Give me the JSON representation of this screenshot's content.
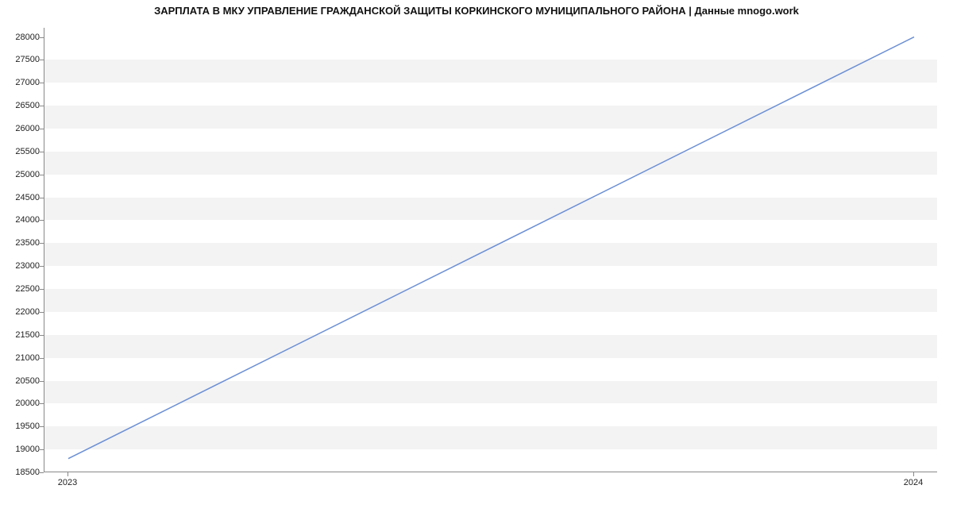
{
  "chart_data": {
    "type": "line",
    "title": "ЗАРПЛАТА В МКУ УПРАВЛЕНИЕ ГРАЖДАНСКОЙ ЗАЩИТЫ КОРКИНСКОГО МУНИЦИПАЛЬНОГО РАЙОНА | Данные mnogo.work",
    "xlabel": "",
    "ylabel": "",
    "x_categories": [
      "2023",
      "2024"
    ],
    "y_ticks": [
      18500,
      19000,
      19500,
      20000,
      20500,
      21000,
      21500,
      22000,
      22500,
      23000,
      23500,
      24000,
      24500,
      25000,
      25500,
      26000,
      26500,
      27000,
      27500,
      28000
    ],
    "ylim": [
      18500,
      28200
    ],
    "series": [
      {
        "name": "salary",
        "x": [
          "2023",
          "2024"
        ],
        "values": [
          18800,
          28000
        ]
      }
    ],
    "line_color": "#6b8fd4",
    "band_color": "#f3f3f4"
  }
}
